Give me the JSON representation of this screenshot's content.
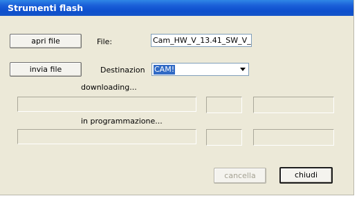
{
  "window": {
    "title": "Strumenti flash"
  },
  "open_file": {
    "button_label": "apri file",
    "file_label": "File:",
    "file_value": "Cam_HW_V_13.41_SW_V_"
  },
  "send_file": {
    "button_label": "invia file",
    "destination_label": "Destinazion",
    "destination_selected": "CAM!"
  },
  "download": {
    "label": "downloading..."
  },
  "programming": {
    "label": "in programmazione..."
  },
  "actions": {
    "cancel_label": "cancella",
    "close_label": "chiudi"
  }
}
